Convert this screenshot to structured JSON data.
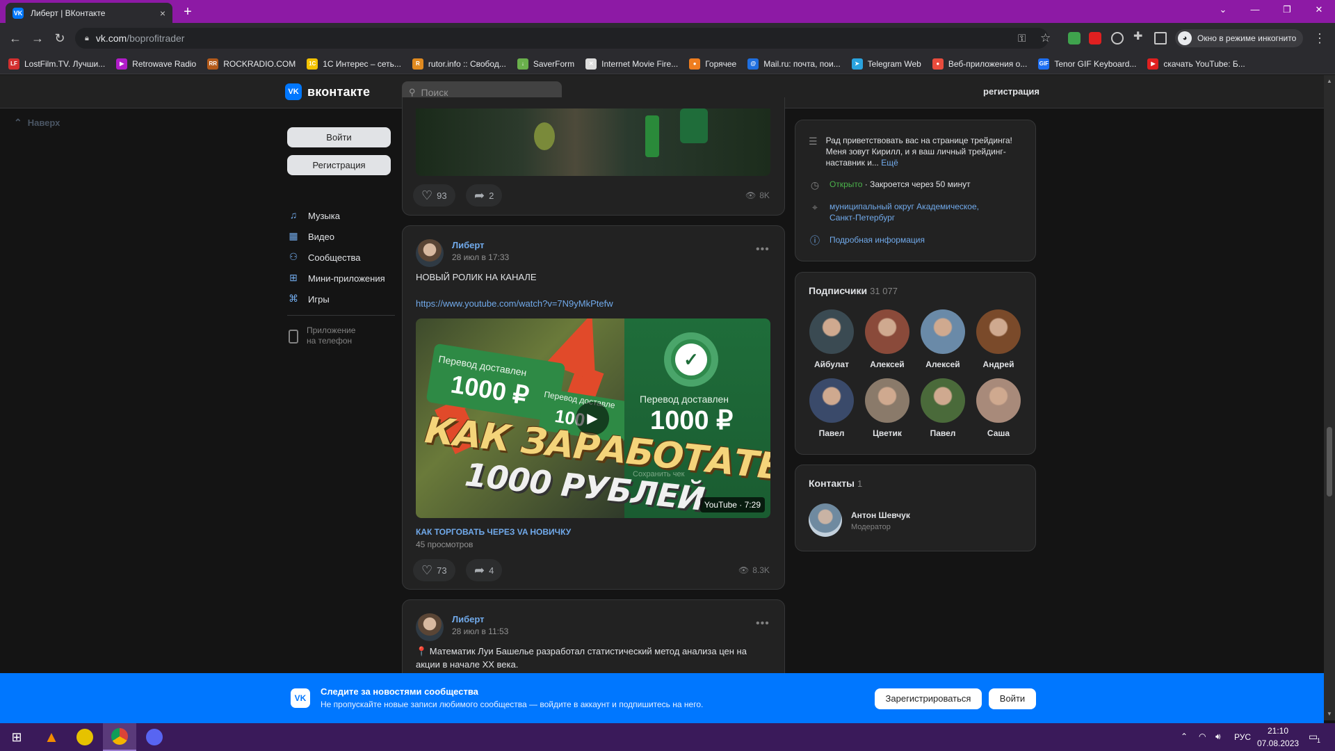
{
  "browser": {
    "tab_title": "Либерт | ВКонтакте",
    "tab_favicon": "VK",
    "close_tab": "×",
    "new_tab": "+",
    "url_host": "vk.com",
    "url_path": "/boprofitrader",
    "incognito_label": "Окно в режиме инкогнито",
    "bookmarks": [
      {
        "label": "LostFilm.TV. Лучши...",
        "color": "#d32f2f",
        "glyph": "LF"
      },
      {
        "label": "Retrowave Radio",
        "color": "#b11cc9",
        "glyph": "▶"
      },
      {
        "label": "ROCKRADIO.COM",
        "color": "#b35a1a",
        "glyph": "RR"
      },
      {
        "label": "1С Интерес – сеть...",
        "color": "#f2c200",
        "glyph": "1С"
      },
      {
        "label": "rutor.info :: Свобод...",
        "color": "#e08a20",
        "glyph": "R"
      },
      {
        "label": "SaverForm",
        "color": "#6ab04c",
        "glyph": "↓"
      },
      {
        "label": "Internet Movie Fire...",
        "color": "#dddddd",
        "glyph": "✕"
      },
      {
        "label": "Горячее",
        "color": "#ef7d1f",
        "glyph": "●"
      },
      {
        "label": "Mail.ru: почта, пои...",
        "color": "#1f6fe0",
        "glyph": "@"
      },
      {
        "label": "Telegram Web",
        "color": "#2aa3df",
        "glyph": "➤"
      },
      {
        "label": "Веб-приложения о...",
        "color": "#e84c3d",
        "glyph": "●"
      },
      {
        "label": "Tenor GIF Keyboard...",
        "color": "#1e6ff2",
        "glyph": "GIF"
      },
      {
        "label": "скачать YouTube: Б...",
        "color": "#e02020",
        "glyph": "▶"
      }
    ]
  },
  "header": {
    "logo_text": "вконтакте",
    "logo_mark": "VK",
    "search_placeholder": "Поиск",
    "register_link": "регистрация"
  },
  "left": {
    "back_to_top": "Наверх",
    "login_button": "Войти",
    "register_button": "Регистрация",
    "menu": [
      {
        "label": "Музыка",
        "icon": "music-icon",
        "glyph": "♫"
      },
      {
        "label": "Видео",
        "icon": "video-icon",
        "glyph": "▦"
      },
      {
        "label": "Сообщества",
        "icon": "communities-icon",
        "glyph": "⚇"
      },
      {
        "label": "Мини-приложения",
        "icon": "mini-apps-icon",
        "glyph": "⊞"
      },
      {
        "label": "Игры",
        "icon": "games-icon",
        "glyph": "⌘"
      }
    ],
    "app_label_line1": "Приложение",
    "app_label_line2": "на телефон"
  },
  "posts": [
    {
      "likes": "93",
      "shares": "2",
      "views": "8K"
    },
    {
      "author": "Либерт",
      "date": "28 июл в 17:33",
      "text": "НОВЫЙ РОЛИК НА КАНАЛЕ",
      "link": "https://www.youtube.com/watch?v=7N9yMkPtefw",
      "video": {
        "card_label": "Перевод доставлен",
        "card_sum": "1000 ₽",
        "card_label_small": "Перевод доставле",
        "card_sum_small": "100",
        "right_title": "Перевод доставлен",
        "right_sum": "1000 ₽",
        "right_small": "Сохранить чек",
        "headline1": "КАК ЗАРАБОТАТЬ",
        "headline2": "1000 РУБЛЕЙ",
        "badge": "YouTube · 7:29"
      },
      "video_title": "КАК ТОРГОВАТЬ ЧЕРЕЗ VA НОВИЧКУ",
      "video_views": "45 просмотров",
      "likes": "73",
      "shares": "4",
      "views": "8.3K"
    },
    {
      "author": "Либерт",
      "date": "28 июл в 11:53",
      "text_line1": "📍 Математик Луи Башелье разработал статистический метод анализа цен на",
      "text_line2": "акции в начале XX века."
    }
  ],
  "info": {
    "description": "Рад приветствовать вас на странице трейдинга! Меня зовут Кирилл, и я ваш личный трейдинг-наставник и...",
    "more": "Ещё",
    "open_status": "Открыто",
    "closes": " · Закроется через 50 минут",
    "address_line1": "муниципальный округ Академическое,",
    "address_line2": "Санкт-Петербург",
    "details_link": "Подробная информация"
  },
  "subscribers": {
    "title": "Подписчики",
    "count": "31 077",
    "people": [
      {
        "name": "Айбулат",
        "color": "#3a4a52"
      },
      {
        "name": "Алексей",
        "color": "#8a4a3a"
      },
      {
        "name": "Алексей",
        "color": "#6a8aa8"
      },
      {
        "name": "Андрей",
        "color": "#7a4a2a"
      },
      {
        "name": "Павел",
        "color": "#3a4a6a"
      },
      {
        "name": "Цветик",
        "color": "#8a7a6a"
      },
      {
        "name": "Павел",
        "color": "#4a6a3a"
      },
      {
        "name": "Саша",
        "color": "#a88a7a"
      }
    ]
  },
  "contacts": {
    "title": "Контакты",
    "count": "1",
    "name": "Антон Шевчук",
    "role": "Модератор"
  },
  "banner": {
    "logo": "VK",
    "title": "Следите за новостями сообщества",
    "subtitle": "Не пропускайте новые записи любимого сообщества — войдите в аккаунт и подпишитесь на него.",
    "register_button": "Зарегистрироваться",
    "login_button": "Войти"
  },
  "taskbar": {
    "language": "РУС",
    "time": "21:10",
    "date": "07.08.2023",
    "notifications": "1"
  },
  "colors": {
    "vk_blue": "#0077ff",
    "link_blue": "#71aaeb",
    "open_green": "#4bb34b",
    "chrome_tabbar": "#8d1aa5"
  }
}
